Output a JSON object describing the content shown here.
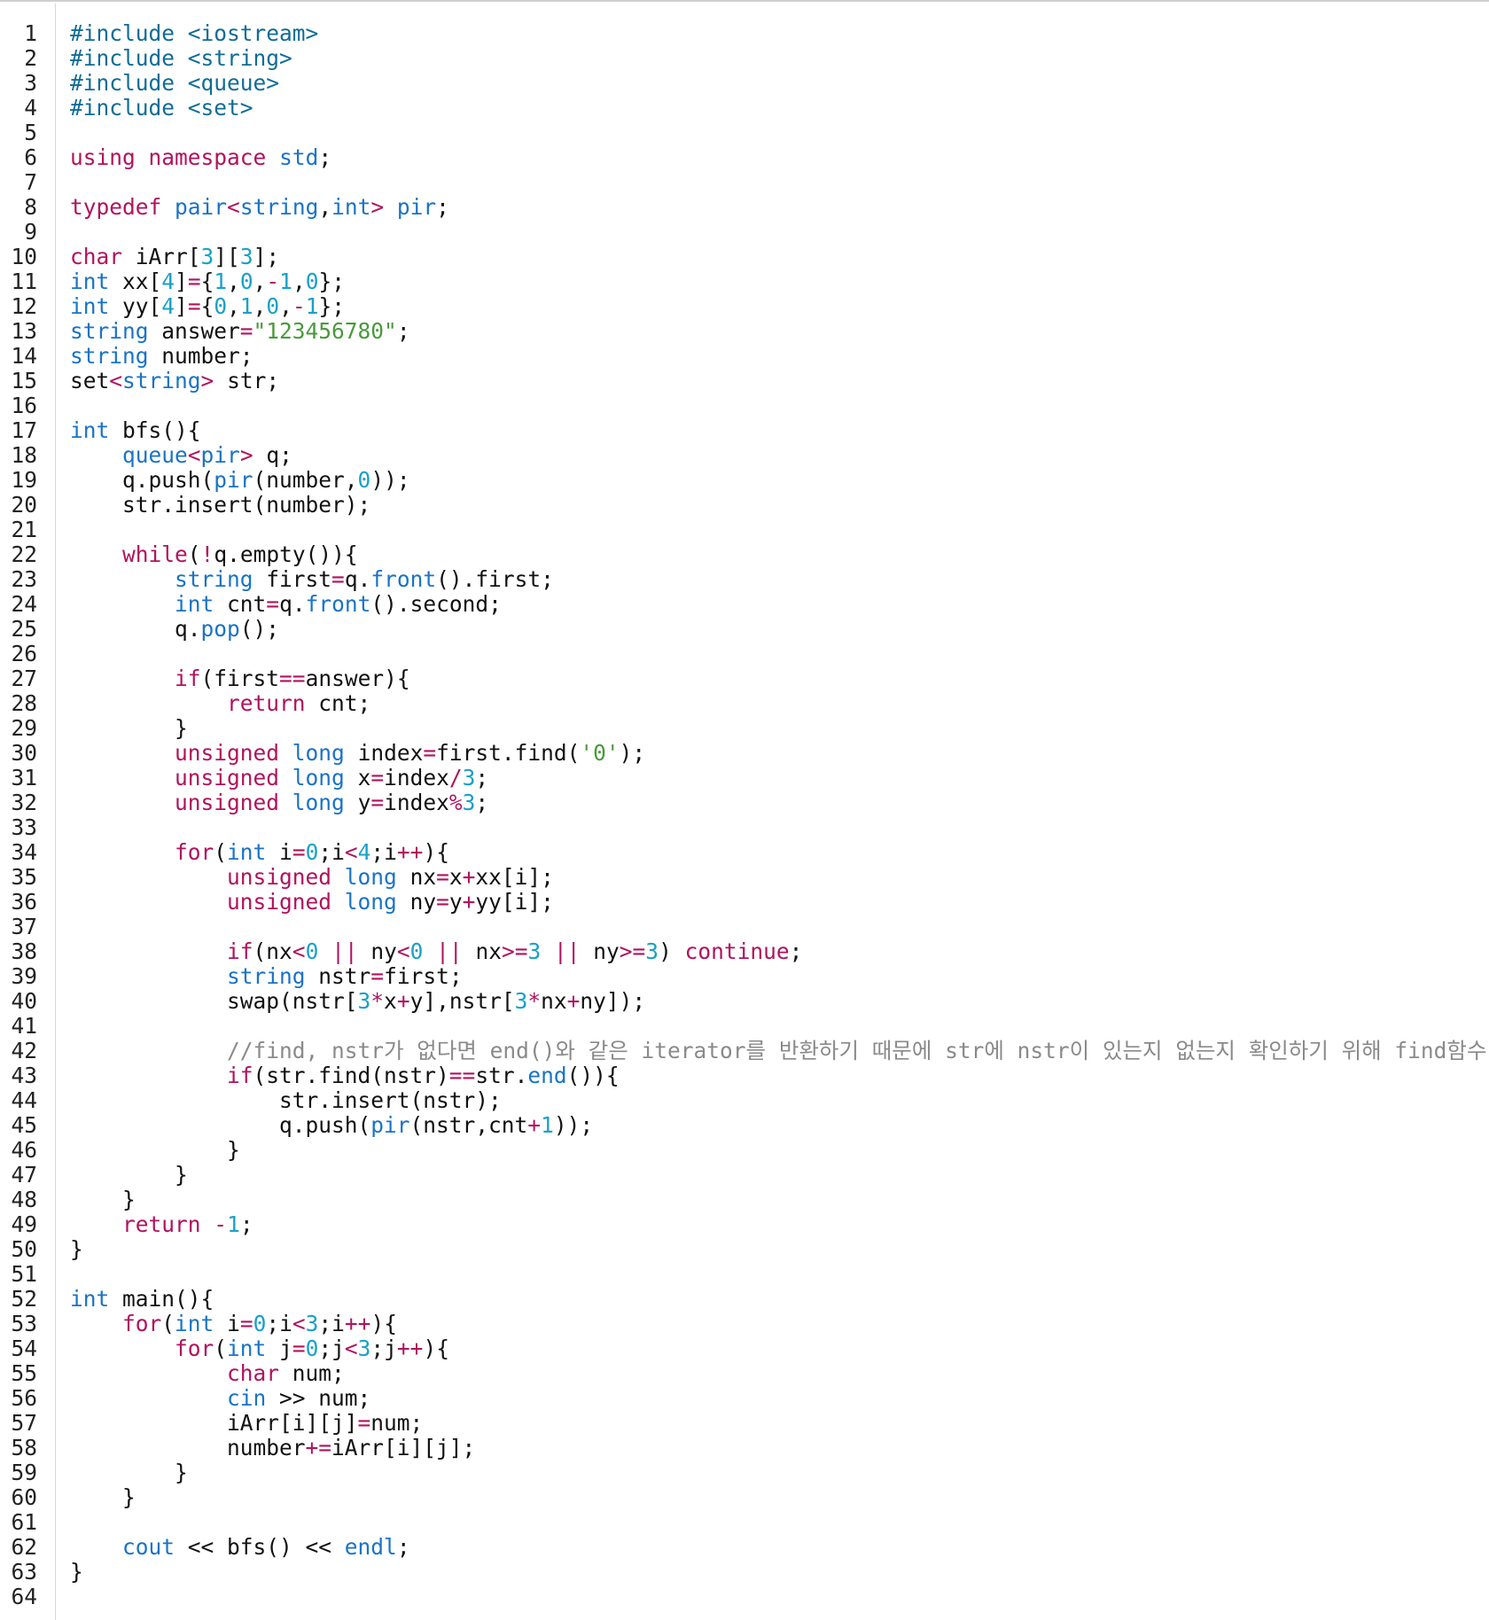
{
  "editor": {
    "language": "cpp",
    "lines": [
      "#include <iostream>",
      "#include <string>",
      "#include <queue>",
      "#include <set>",
      "",
      "using namespace std;",
      "",
      "typedef pair<string,int> pir;",
      "",
      "char iArr[3][3];",
      "int xx[4]={1,0,-1,0};",
      "int yy[4]={0,1,0,-1};",
      "string answer=\"123456780\";",
      "string number;",
      "set<string> str;",
      "",
      "int bfs(){",
      "    queue<pir> q;",
      "    q.push(pir(number,0));",
      "    str.insert(number);",
      "",
      "    while(!q.empty()){",
      "        string first=q.front().first;",
      "        int cnt=q.front().second;",
      "        q.pop();",
      "",
      "        if(first==answer){",
      "            return cnt;",
      "        }",
      "        unsigned long index=first.find('0');",
      "        unsigned long x=index/3;",
      "        unsigned long y=index%3;",
      "",
      "        for(int i=0;i<4;i++){",
      "            unsigned long nx=x+xx[i];",
      "            unsigned long ny=y+yy[i];",
      "",
      "            if(nx<0 || ny<0 || nx>=3 || ny>=3) continue;",
      "            string nstr=first;",
      "            swap(nstr[3*x+y],nstr[3*nx+ny]);",
      "",
      "            //find, nstr가 없다면 end()와 같은 iterator를 반환하기 때문에 str에 nstr이 있는지 없는지 확인하기 위해 find함수 사용",
      "            if(str.find(nstr)==str.end()){",
      "                str.insert(nstr);",
      "                q.push(pir(nstr,cnt+1));",
      "            }",
      "        }",
      "    }",
      "    return -1;",
      "}",
      "",
      "int main(){",
      "    for(int i=0;i<3;i++){",
      "        for(int j=0;j<3;j++){",
      "            char num;",
      "            cin >> num;",
      "            iArr[i][j]=num;",
      "            number+=iArr[i][j];",
      "        }",
      "    }",
      "",
      "    cout << bfs() << endl;",
      "}",
      ""
    ]
  },
  "colors": {
    "keyword": "#b0135d",
    "type": "#1a73c6",
    "number": "#19a0c9",
    "string": "#4a9a3c",
    "comment": "#8a8a8a",
    "preprocessor": "#0f6c96",
    "text": "#111111",
    "gutter_border": "#d8d8d8"
  }
}
